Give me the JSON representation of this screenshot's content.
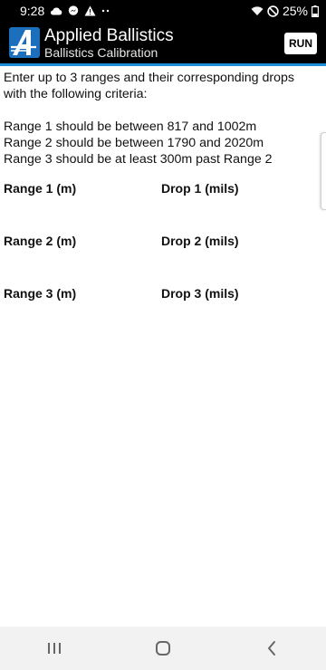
{
  "status_bar": {
    "time": "9:28",
    "battery_percent": "25%",
    "icons": [
      "cloud-icon",
      "messenger-icon",
      "warning-icon",
      "more-dots-icon",
      "wifi-icon",
      "do-not-disturb-icon",
      "battery-icon"
    ]
  },
  "app_bar": {
    "title": "Applied Ballistics",
    "subtitle": "Ballistics Calibration",
    "run_label": "RUN",
    "accent_color": "#1c8fd6"
  },
  "instructions": {
    "intro": "Enter up to 3 ranges and their corresponding drops with the following criteria:",
    "criteria": [
      "Range 1 should be between 817 and 1002m",
      "Range 2 should be between 1790 and 2020m",
      "Range 3 should be at least 300m past Range 2"
    ]
  },
  "fields": [
    {
      "range_label": "Range 1 (m)",
      "range_value": "",
      "drop_label": "Drop 1 (mils)",
      "drop_value": ""
    },
    {
      "range_label": "Range 2 (m)",
      "range_value": "",
      "drop_label": "Drop 2 (mils)",
      "drop_value": ""
    },
    {
      "range_label": "Range 3 (m)",
      "range_value": "",
      "drop_label": "Drop 3 (mils)",
      "drop_value": ""
    }
  ],
  "nav_bar": {
    "icons": [
      "recents-icon",
      "home-icon",
      "back-icon"
    ]
  }
}
